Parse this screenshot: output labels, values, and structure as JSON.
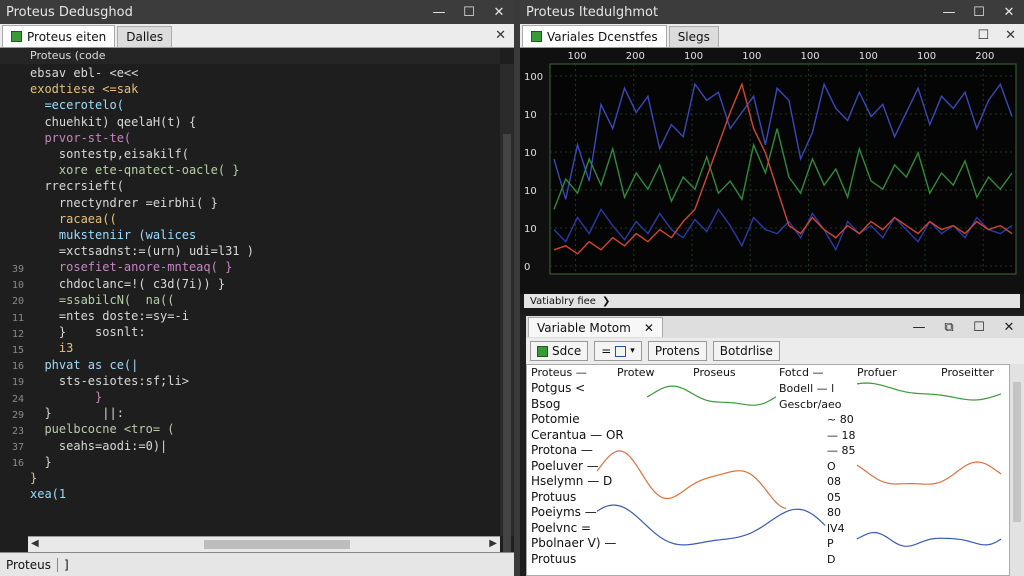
{
  "left_window": {
    "title": "Proteus Dedusghod",
    "controls": {
      "minimize": "—",
      "maximize": "☐",
      "close": "✕"
    },
    "tabs": [
      {
        "label": "Proteus eiten",
        "icon": "file-icon"
      },
      {
        "label": "Dalles"
      }
    ],
    "tab_close": "✕",
    "breadcrumb": "Proteus (code",
    "line_numbers": [
      "39",
      "10",
      "20",
      "11",
      "12",
      "15",
      "16",
      "19",
      "24",
      "29",
      "23",
      "37",
      "16"
    ],
    "code_lines": [
      "ebsav ebl- <e<<",
      "exodtiese <=sak",
      "  =ecerotelo(",
      "  chuehkit) qeelaH(t) {",
      "  prvor-st-te(",
      "    sontestp,eisakilf(",
      "    xore ete-qnatect-oacle( }",
      "  rrecrsieft(",
      "    rnectyndrer =eirbhi( }",
      "    racaea((",
      "    muksteniir (walices",
      "    =xctsadnst:=(urn) udi=l31 )",
      "    rosefiet-anore-mnteaq( }",
      "    chdoclanc=!( c3d(7i)) }",
      "    =ssabilcN(  na((",
      "    =ntes doste:=sy=-i",
      "    }    sosnlt:",
      "    i3",
      "  phvat as ce(|",
      "    sts-esiotes:sf;li>",
      "         }",
      "  }       ||:",
      "  puelbcocne <tro= (",
      "    seahs=aodi:=0)|",
      "  }",
      "}",
      "xea(1"
    ],
    "status": {
      "left": "Proteus",
      "right": "]"
    }
  },
  "right_top_window": {
    "title": "Proteus Itedulghmot",
    "controls": {
      "minimize": "—",
      "maximize": "☐",
      "close": "✕"
    },
    "tabs": [
      {
        "label": "Variales Dcenstfes",
        "icon": "file-icon"
      },
      {
        "label": "Slegs"
      }
    ],
    "tab_close": "✕",
    "tab_max": "☐",
    "x_ticks": [
      "100",
      "200",
      "100",
      "100",
      "100",
      "100",
      "100",
      "200"
    ],
    "y_ticks": [
      "100",
      "10",
      "10",
      "10",
      "10",
      "0"
    ],
    "status_label": "Vatiablry fiee",
    "status_arrow": "❯"
  },
  "chart_data": {
    "type": "line",
    "x_ticks": [
      "100",
      "200",
      "100",
      "100",
      "100",
      "100",
      "100",
      "200"
    ],
    "y_ticks": [
      "100",
      "10",
      "10",
      "10",
      "10",
      "0"
    ],
    "grid": true,
    "series": [
      {
        "color": "#3a48b8",
        "values": [
          0.55,
          0.35,
          0.62,
          0.44,
          0.82,
          0.7,
          0.9,
          0.78,
          0.86,
          0.6,
          0.72,
          0.66,
          0.92,
          0.84,
          0.88,
          0.7,
          0.78,
          0.86,
          0.62,
          0.9,
          0.84,
          0.55,
          0.68,
          0.92,
          0.8,
          0.74,
          0.88,
          0.76,
          0.82,
          0.66,
          0.78,
          0.9,
          0.72,
          0.86,
          0.8,
          0.88,
          0.7,
          0.84,
          0.92,
          0.76
        ]
      },
      {
        "color": "#2c8c3c",
        "values": [
          0.3,
          0.45,
          0.38,
          0.55,
          0.42,
          0.6,
          0.36,
          0.48,
          0.4,
          0.52,
          0.34,
          0.46,
          0.4,
          0.56,
          0.38,
          0.44,
          0.35,
          0.62,
          0.48,
          0.7,
          0.46,
          0.38,
          0.55,
          0.42,
          0.5,
          0.36,
          0.6,
          0.44,
          0.4,
          0.52,
          0.46,
          0.58,
          0.38,
          0.48,
          0.42,
          0.54,
          0.36,
          0.46,
          0.4,
          0.48
        ]
      },
      {
        "color": "#2a3aa8",
        "values": [
          0.2,
          0.14,
          0.26,
          0.18,
          0.3,
          0.22,
          0.15,
          0.24,
          0.18,
          0.28,
          0.2,
          0.16,
          0.25,
          0.19,
          0.3,
          0.22,
          0.12,
          0.26,
          0.2,
          0.18,
          0.24,
          0.16,
          0.28,
          0.2,
          0.1,
          0.24,
          0.18,
          0.22,
          0.16,
          0.26,
          0.2,
          0.14,
          0.24,
          0.18,
          0.22,
          0.16,
          0.26,
          0.2,
          0.18,
          0.22
        ]
      },
      {
        "color": "#d2462e",
        "values": [
          0.1,
          0.12,
          0.08,
          0.14,
          0.1,
          0.16,
          0.12,
          0.18,
          0.14,
          0.2,
          0.16,
          0.24,
          0.3,
          0.46,
          0.62,
          0.78,
          0.92,
          0.7,
          0.58,
          0.4,
          0.22,
          0.18,
          0.26,
          0.2,
          0.16,
          0.22,
          0.18,
          0.24,
          0.2,
          0.26,
          0.22,
          0.18,
          0.24,
          0.2,
          0.22,
          0.18,
          0.24,
          0.2,
          0.22,
          0.18
        ]
      }
    ]
  },
  "right_bottom_window": {
    "title": "Variable Motom",
    "title_close": "✕",
    "controls": {
      "minimize": "—",
      "restore": "⧉",
      "maximize": "☐",
      "close": "✕"
    },
    "toolbar": [
      {
        "label": "Sdce",
        "icon": "table-icon"
      },
      {
        "label": "=",
        "icon": "square-icon",
        "caret": "▾"
      },
      {
        "label": "Protens"
      },
      {
        "label": "Botdrlise"
      }
    ],
    "columns": [
      "Proteus —",
      "Protew",
      "Proseus",
      "Fotcd —",
      "Profuer",
      "Proseitter"
    ],
    "names": [
      "Potgus <",
      "Bsog",
      "Potomie",
      "Cerantua — OR",
      "Protona —",
      "Poeluver —",
      "Hselymn — D",
      "Protuus",
      "Poeiyms —",
      "Poelvnc =",
      "Pbolnaer V) —",
      "Protuus"
    ],
    "values": [
      "Bodell — l",
      "Gescbr/aeo",
      "~ 80",
      "— 18",
      "— 85",
      "O",
      "08",
      "05",
      "80",
      "lV4",
      "P",
      "D"
    ]
  }
}
